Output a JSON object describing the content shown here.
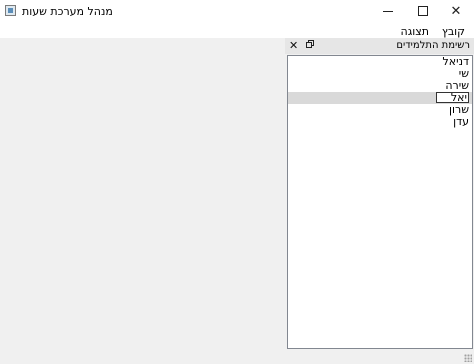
{
  "window": {
    "title": "מנהל מערכת שעות",
    "minimize_glyph": "—",
    "maximize_glyph": "☐",
    "close_glyph": "✕"
  },
  "menubar": {
    "items": [
      {
        "label": "קובץ"
      },
      {
        "label": "תצוגה"
      }
    ]
  },
  "dock": {
    "title": "רשימת התלמידים",
    "close_glyph": "✕"
  },
  "students": {
    "items": [
      {
        "label": "דניאל"
      },
      {
        "label": "שי"
      },
      {
        "label": "שירה"
      },
      {
        "label": "יאל",
        "selected": true,
        "editing_value": "יאל"
      },
      {
        "label": "שרון"
      },
      {
        "label": "עדן"
      }
    ]
  }
}
